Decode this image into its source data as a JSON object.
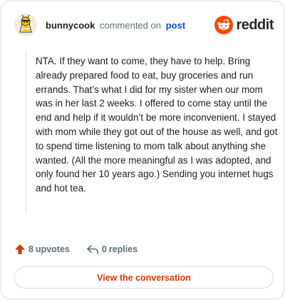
{
  "header": {
    "username": "bunnycook",
    "action_text": "commented on",
    "post_link": "post",
    "brand_wordmark": "reddit",
    "avatar_icon": "bee-avatar-icon",
    "brand_icon": "reddit-alien-icon"
  },
  "comment": {
    "body": "NTA. If they want to come, they have to help. Bring already prepared food to eat, buy groceries and run errands. That’s what I did for my sister when our mom was in her last 2 weeks. I offered to come stay until the end and help if it wouldn’t be more inconvenient. I stayed with mom while they got out of the house as well, and got to spend time listening to mom talk about anything she wanted. (All the more meaningful as I was adopted, and only found her 10 years ago.) Sending you internet hugs and hot tea."
  },
  "stats": {
    "upvote_count": "8",
    "upvote_label": "upvotes",
    "upvote_icon": "upvote-arrow-icon",
    "reply_count": "0",
    "reply_label": "replies",
    "reply_icon": "reply-arrow-icon"
  },
  "cta": {
    "label": "View the conversation"
  },
  "colors": {
    "brand_orange": "#ff4500",
    "upvote_orange": "#d93900",
    "link_blue": "#0b4fd4",
    "muted_text": "#576f76",
    "border": "#dcdcdc"
  }
}
